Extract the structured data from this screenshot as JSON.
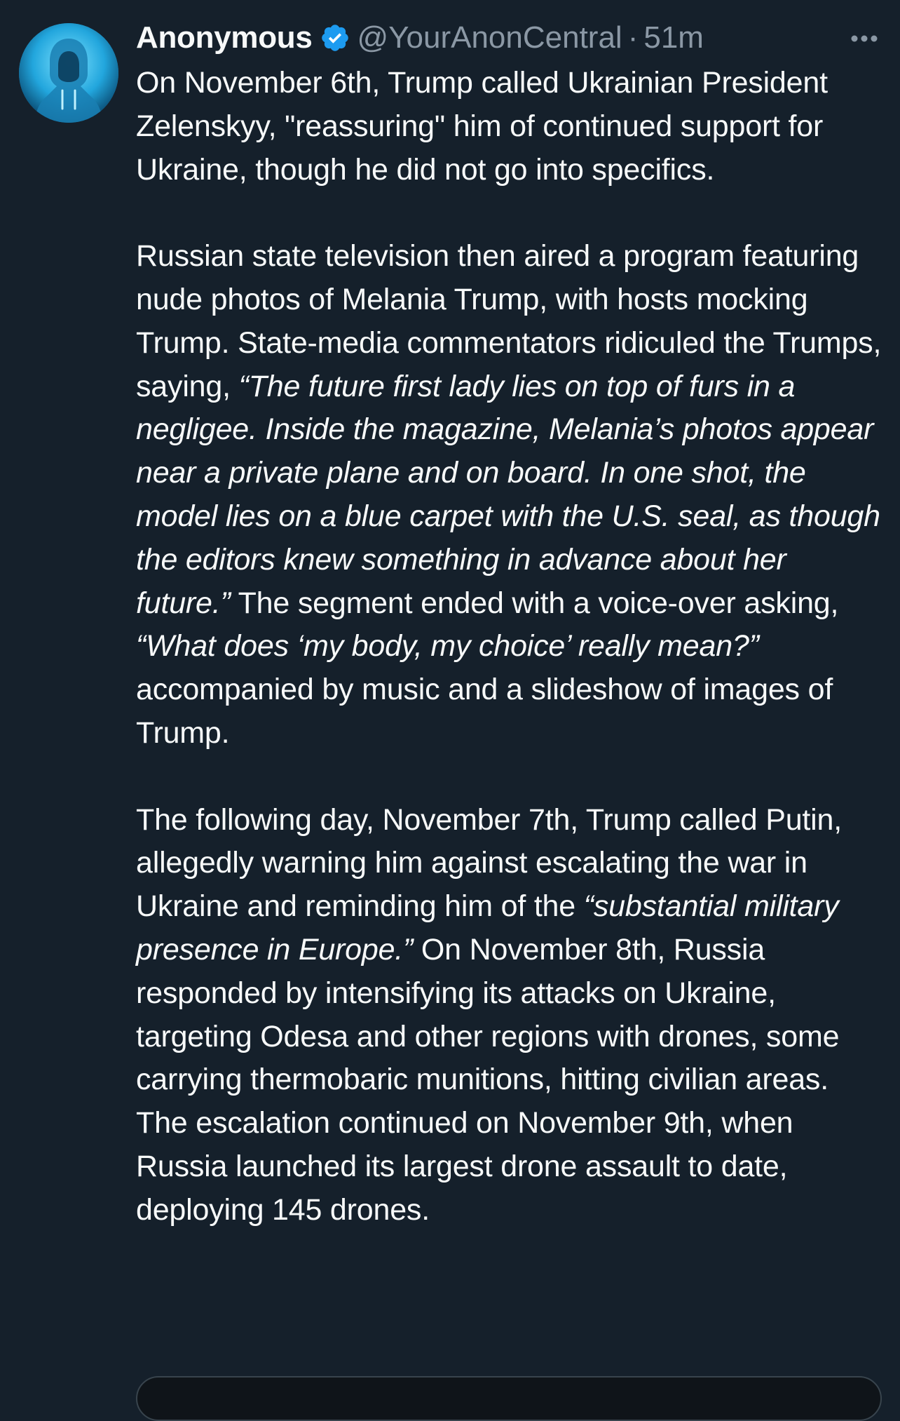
{
  "tweet": {
    "author": {
      "display_name": "Anonymous",
      "handle": "@YourAnonCentral",
      "verified_icon": "verified-badge-icon",
      "avatar_icon": "hooded-figure-avatar"
    },
    "separator": "·",
    "time": "51m",
    "more_icon": "more-options-icon",
    "paragraph1": "On November 6th, Trump called Ukrainian President Zelenskyy, \"reassuring\" him of continued support for Ukraine, though he did not go into specifics.",
    "paragraph2": {
      "text_a": "Russian state television then aired a program featuring nude photos of Melania Trump, with hosts mocking Trump. State-media commentators ridiculed the Trumps, saying, ",
      "quote1": "“The future first lady lies on top of furs in a negligee. Inside the magazine, Melania’s photos appear near a private plane and on board. In one shot, the model lies on a blue carpet with the U.S. seal, as though the editors knew something in advance about her future.”",
      "text_b": " The segment ended with a voice-over asking, ",
      "quote2": "“What does ‘my body, my choice’ really mean?”",
      "text_c": " accompanied by music and a slideshow of images of Trump."
    },
    "paragraph3": {
      "text_a": "The following day, November 7th, Trump called Putin, allegedly warning him against escalating the war in Ukraine and reminding him of the ",
      "quote": "“substantial military presence in Europe.”",
      "text_b": " On November 8th, Russia responded by intensifying its attacks on Ukraine, targeting Odesa and other regions with drones, some carrying thermobaric munitions, hitting civilian areas. The escalation continued on November 9th, when Russia launched its largest drone assault to date, deploying 145 drones."
    }
  },
  "colors": {
    "background": "#15202b",
    "primary_text": "#f7f9f9",
    "secondary_text": "#8b98a5",
    "verified_blue": "#1d9bf0"
  }
}
